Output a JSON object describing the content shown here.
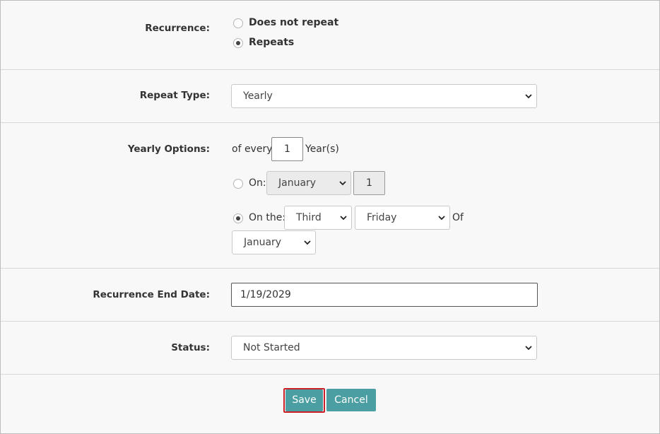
{
  "recurrence": {
    "label": "Recurrence:",
    "options": [
      {
        "label": "Does not repeat",
        "checked": false
      },
      {
        "label": "Repeats",
        "checked": true
      }
    ]
  },
  "repeat_type": {
    "label": "Repeat Type:",
    "value": "Yearly"
  },
  "yearly_options": {
    "label": "Yearly Options:",
    "of_every_text": "of every",
    "interval_value": "1",
    "unit_text": "Year(s)",
    "on": {
      "label": "On:",
      "checked": false,
      "month": "January",
      "day": "1"
    },
    "on_the": {
      "label": "On the:",
      "checked": true,
      "ordinal": "Third",
      "weekday": "Friday",
      "of_text": "Of",
      "month": "January"
    }
  },
  "end_date": {
    "label": "Recurrence End Date:",
    "value": "1/19/2029"
  },
  "status": {
    "label": "Status:",
    "value": "Not Started"
  },
  "actions": {
    "save_label": "Save",
    "cancel_label": "Cancel"
  },
  "colors": {
    "button_bg": "#4b9ea1",
    "focus_outline": "#cc1f27"
  }
}
